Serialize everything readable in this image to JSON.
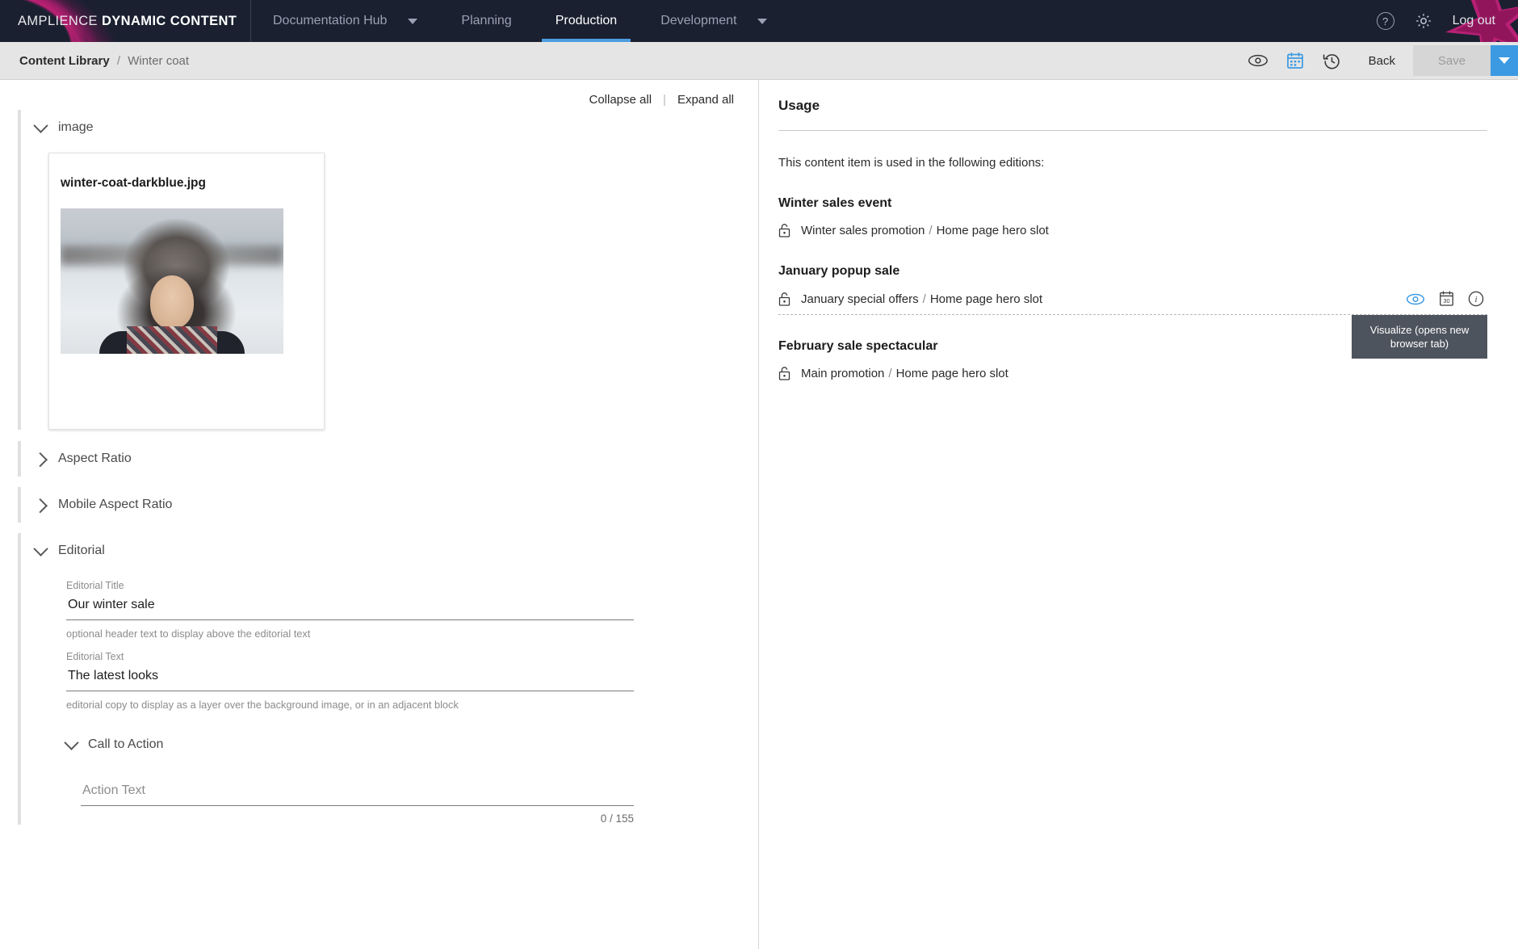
{
  "topbar": {
    "brand_light": "AMPLIENCE ",
    "brand_bold": "DYNAMIC CONTENT",
    "nav": [
      {
        "label": "Documentation Hub",
        "has_caret": true,
        "active": false
      },
      {
        "label": "Planning",
        "has_caret": false,
        "active": false
      },
      {
        "label": "Production",
        "has_caret": false,
        "active": true
      },
      {
        "label": "Development",
        "has_caret": true,
        "active": false
      }
    ],
    "help_icon": "help-circle-icon",
    "settings_icon": "gear-icon",
    "logout_label": "Log out",
    "accent_color": "#4d9de0",
    "background_color": "#1b2030"
  },
  "subbar": {
    "breadcrumb_root": "Content Library",
    "breadcrumb_sep": "/",
    "breadcrumb_leaf": "Winter coat",
    "icons": [
      "eye-icon",
      "calendar-icon",
      "history-icon"
    ],
    "back_label": "Back",
    "save_label": "Save",
    "save_dropdown_icon": "chevron-down-icon",
    "save_dropdown_color": "#3c9ae2"
  },
  "left": {
    "collapse_all": "Collapse all",
    "divider": "|",
    "expand_all": "Expand all",
    "sections": {
      "image": {
        "title": "image",
        "expanded": true,
        "card": {
          "filename": "winter-coat-darkblue.jpg"
        }
      },
      "aspect_ratio": {
        "title": "Aspect Ratio",
        "expanded": false
      },
      "mobile_aspect_ratio": {
        "title": "Mobile Aspect Ratio",
        "expanded": false
      },
      "editorial": {
        "title": "Editorial",
        "expanded": true,
        "fields": [
          {
            "label": "Editorial Title",
            "value": "Our winter sale",
            "placeholder": "",
            "help": "optional header text to display above the editorial text"
          },
          {
            "label": "Editorial Text",
            "value": "The latest looks",
            "placeholder": "",
            "help": "editorial copy to display as a layer over the background image, or in an adjacent block"
          }
        ],
        "call_to_action": {
          "title": "Call to Action",
          "expanded": true,
          "action_text_placeholder": "Action Text",
          "action_text_value": "",
          "counter": "0 / 155"
        }
      }
    }
  },
  "right": {
    "title": "Usage",
    "intro": "This content item is used in the following editions:",
    "editions": [
      {
        "name": "Winter sales event",
        "slot": {
          "edition": "Winter sales promotion",
          "sep": "/",
          "slot_name": "Home page hero slot"
        },
        "lock_icon": "unlock-icon",
        "show_actions": false
      },
      {
        "name": "January popup sale",
        "slot": {
          "edition": "January special offers",
          "sep": "/",
          "slot_name": "Home page hero slot"
        },
        "lock_icon": "unlock-icon",
        "show_actions": true,
        "actions": [
          {
            "icon": "visualize-eye-icon",
            "color": "#3c9ae2"
          },
          {
            "icon": "calendar-30-icon",
            "color": "#4a4a4a"
          },
          {
            "icon": "info-icon",
            "color": "#4a4a4a"
          }
        ],
        "tooltip": "Visualize (opens new browser tab)"
      },
      {
        "name": "February sale spectacular",
        "slot": {
          "edition": "Main promotion",
          "sep": "/",
          "slot_name": "Home page hero slot"
        },
        "lock_icon": "unlock-icon",
        "show_actions": false
      }
    ]
  }
}
